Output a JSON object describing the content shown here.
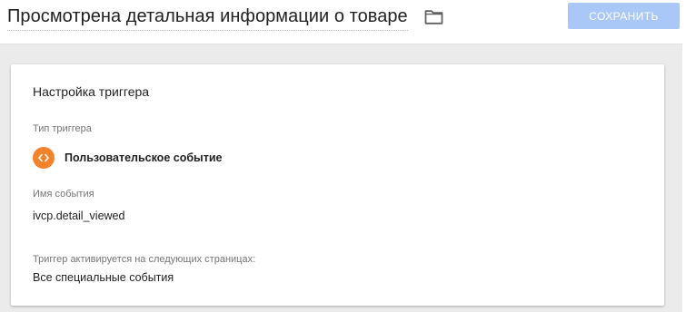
{
  "header": {
    "title": "Просмотрена детальная информации о товаре",
    "folder_icon": "folder-icon",
    "save_label": "СОХРАНИТЬ",
    "save_color": "#a9c8f7"
  },
  "card": {
    "title": "Настройка триггера",
    "trigger_type": {
      "label": "Тип триггера",
      "name": "Пользовательское событие",
      "icon": "code-brackets-icon",
      "icon_color": "#f4822b"
    },
    "event_name": {
      "label": "Имя события",
      "value": "ivcp.detail_viewed"
    },
    "fires_on": {
      "label": "Триггер активируется на следующих страницах:",
      "value": "Все специальные события"
    }
  }
}
